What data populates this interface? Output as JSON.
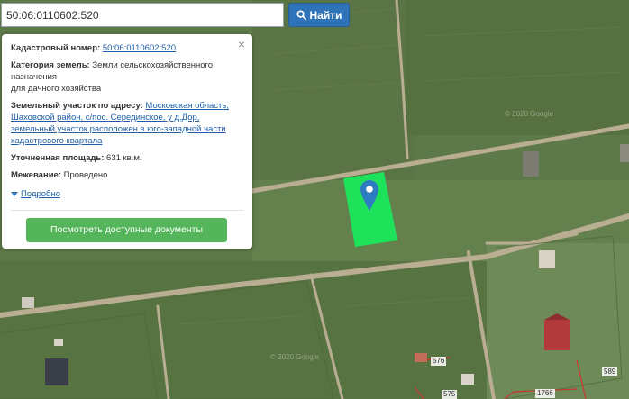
{
  "search": {
    "value": "50:06:0110602:520",
    "button_label": "Найти"
  },
  "panel": {
    "cadastral_label": "Кадастровый номер:",
    "cadastral_value": "50:06:0110602:520",
    "category_label": "Категория земель:",
    "category_value_1": "Земли сельскохозяйственного",
    "category_value_2": "назначения",
    "category_value_3": "для дачного хозяйства",
    "address_label": "Земельный участок по адресу:",
    "address_line_1": "Московская область,",
    "address_line_2": "Шаховской район, с/пос. Серединское, у д.Дор,",
    "address_line_3": "земельный участок расположен в юго-западной части",
    "address_line_4": "кадастрового квартала",
    "area_label": "Уточненная площадь:",
    "area_value": "631 кв.м.",
    "survey_label": "Межевание:",
    "survey_value": "Проведено",
    "more_link": "Подробно",
    "docs_button": "Посмотреть доступные документы",
    "close_symbol": "×"
  },
  "map": {
    "watermark_1": "© 2020 Google",
    "watermark_2": "© 2020 Google",
    "parcel_labels": [
      "576",
      "575",
      "1766",
      "589"
    ]
  },
  "colors": {
    "accent_blue": "#2f74b8",
    "button_green": "#55b55a",
    "parcel_green": "#1ee35a",
    "parcel_border_red": "#c8372f"
  },
  "icons": {
    "search": "search-icon",
    "close": "close-icon",
    "more": "triangle-down-icon",
    "marker": "map-marker-icon"
  }
}
